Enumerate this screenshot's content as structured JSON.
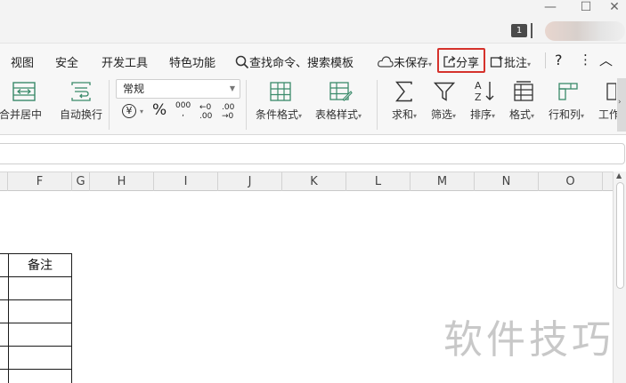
{
  "titlebar": {
    "window_count": "1",
    "minimize": "—",
    "restore": "☐",
    "close": "✕"
  },
  "menubar": {
    "items": [
      "视图",
      "安全",
      "开发工具",
      "特色功能"
    ],
    "search_label": "查找命令、搜索模板",
    "unsaved_label": "未保存",
    "share_label": "分享",
    "comment_label": "批注",
    "help": "?",
    "more": "⋮",
    "collapse": "︿"
  },
  "ribbon": {
    "merge_center": "合并居中",
    "wrap_text": "自动换行",
    "number_format": "常规",
    "currency": "¥",
    "percent": "%",
    "thousands": "000",
    "inc_decimal": "←0\n.00",
    "dec_decimal": ".00\n→0",
    "conditional_format": "条件格式",
    "table_style": "表格样式",
    "sum": "求和",
    "filter": "筛选",
    "sort": "排序",
    "format": "格式",
    "row_col": "行和列",
    "worksheet": "工作"
  },
  "columns": [
    "F",
    "G",
    "H",
    "I",
    "J",
    "K",
    "L",
    "M",
    "N",
    "O"
  ],
  "sheet": {
    "note_header": "备注"
  },
  "watermark": "软件技巧"
}
